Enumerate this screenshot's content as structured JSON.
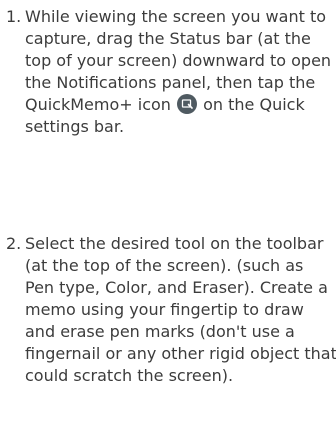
{
  "steps": [
    {
      "number": "1.",
      "text_before_icon": "While viewing the screen you want to capture, drag the Status bar (at the top of your screen) downward to open the Notifications panel, then tap the QuickMemo+ icon",
      "icon": "quickmemo-icon",
      "text_after_icon": "on the Quick settings bar."
    },
    {
      "number": "2.",
      "text": "Select the desired tool on the toolbar (at the top of the screen). (such as Pen type, Color, and Eraser). Create a memo using your fingertip to draw and erase pen marks (don't use a fingernail or any other rigid object that could scratch the screen)."
    }
  ],
  "colors": {
    "text": "#3c3c3c",
    "icon_background": "#4f5a61"
  }
}
